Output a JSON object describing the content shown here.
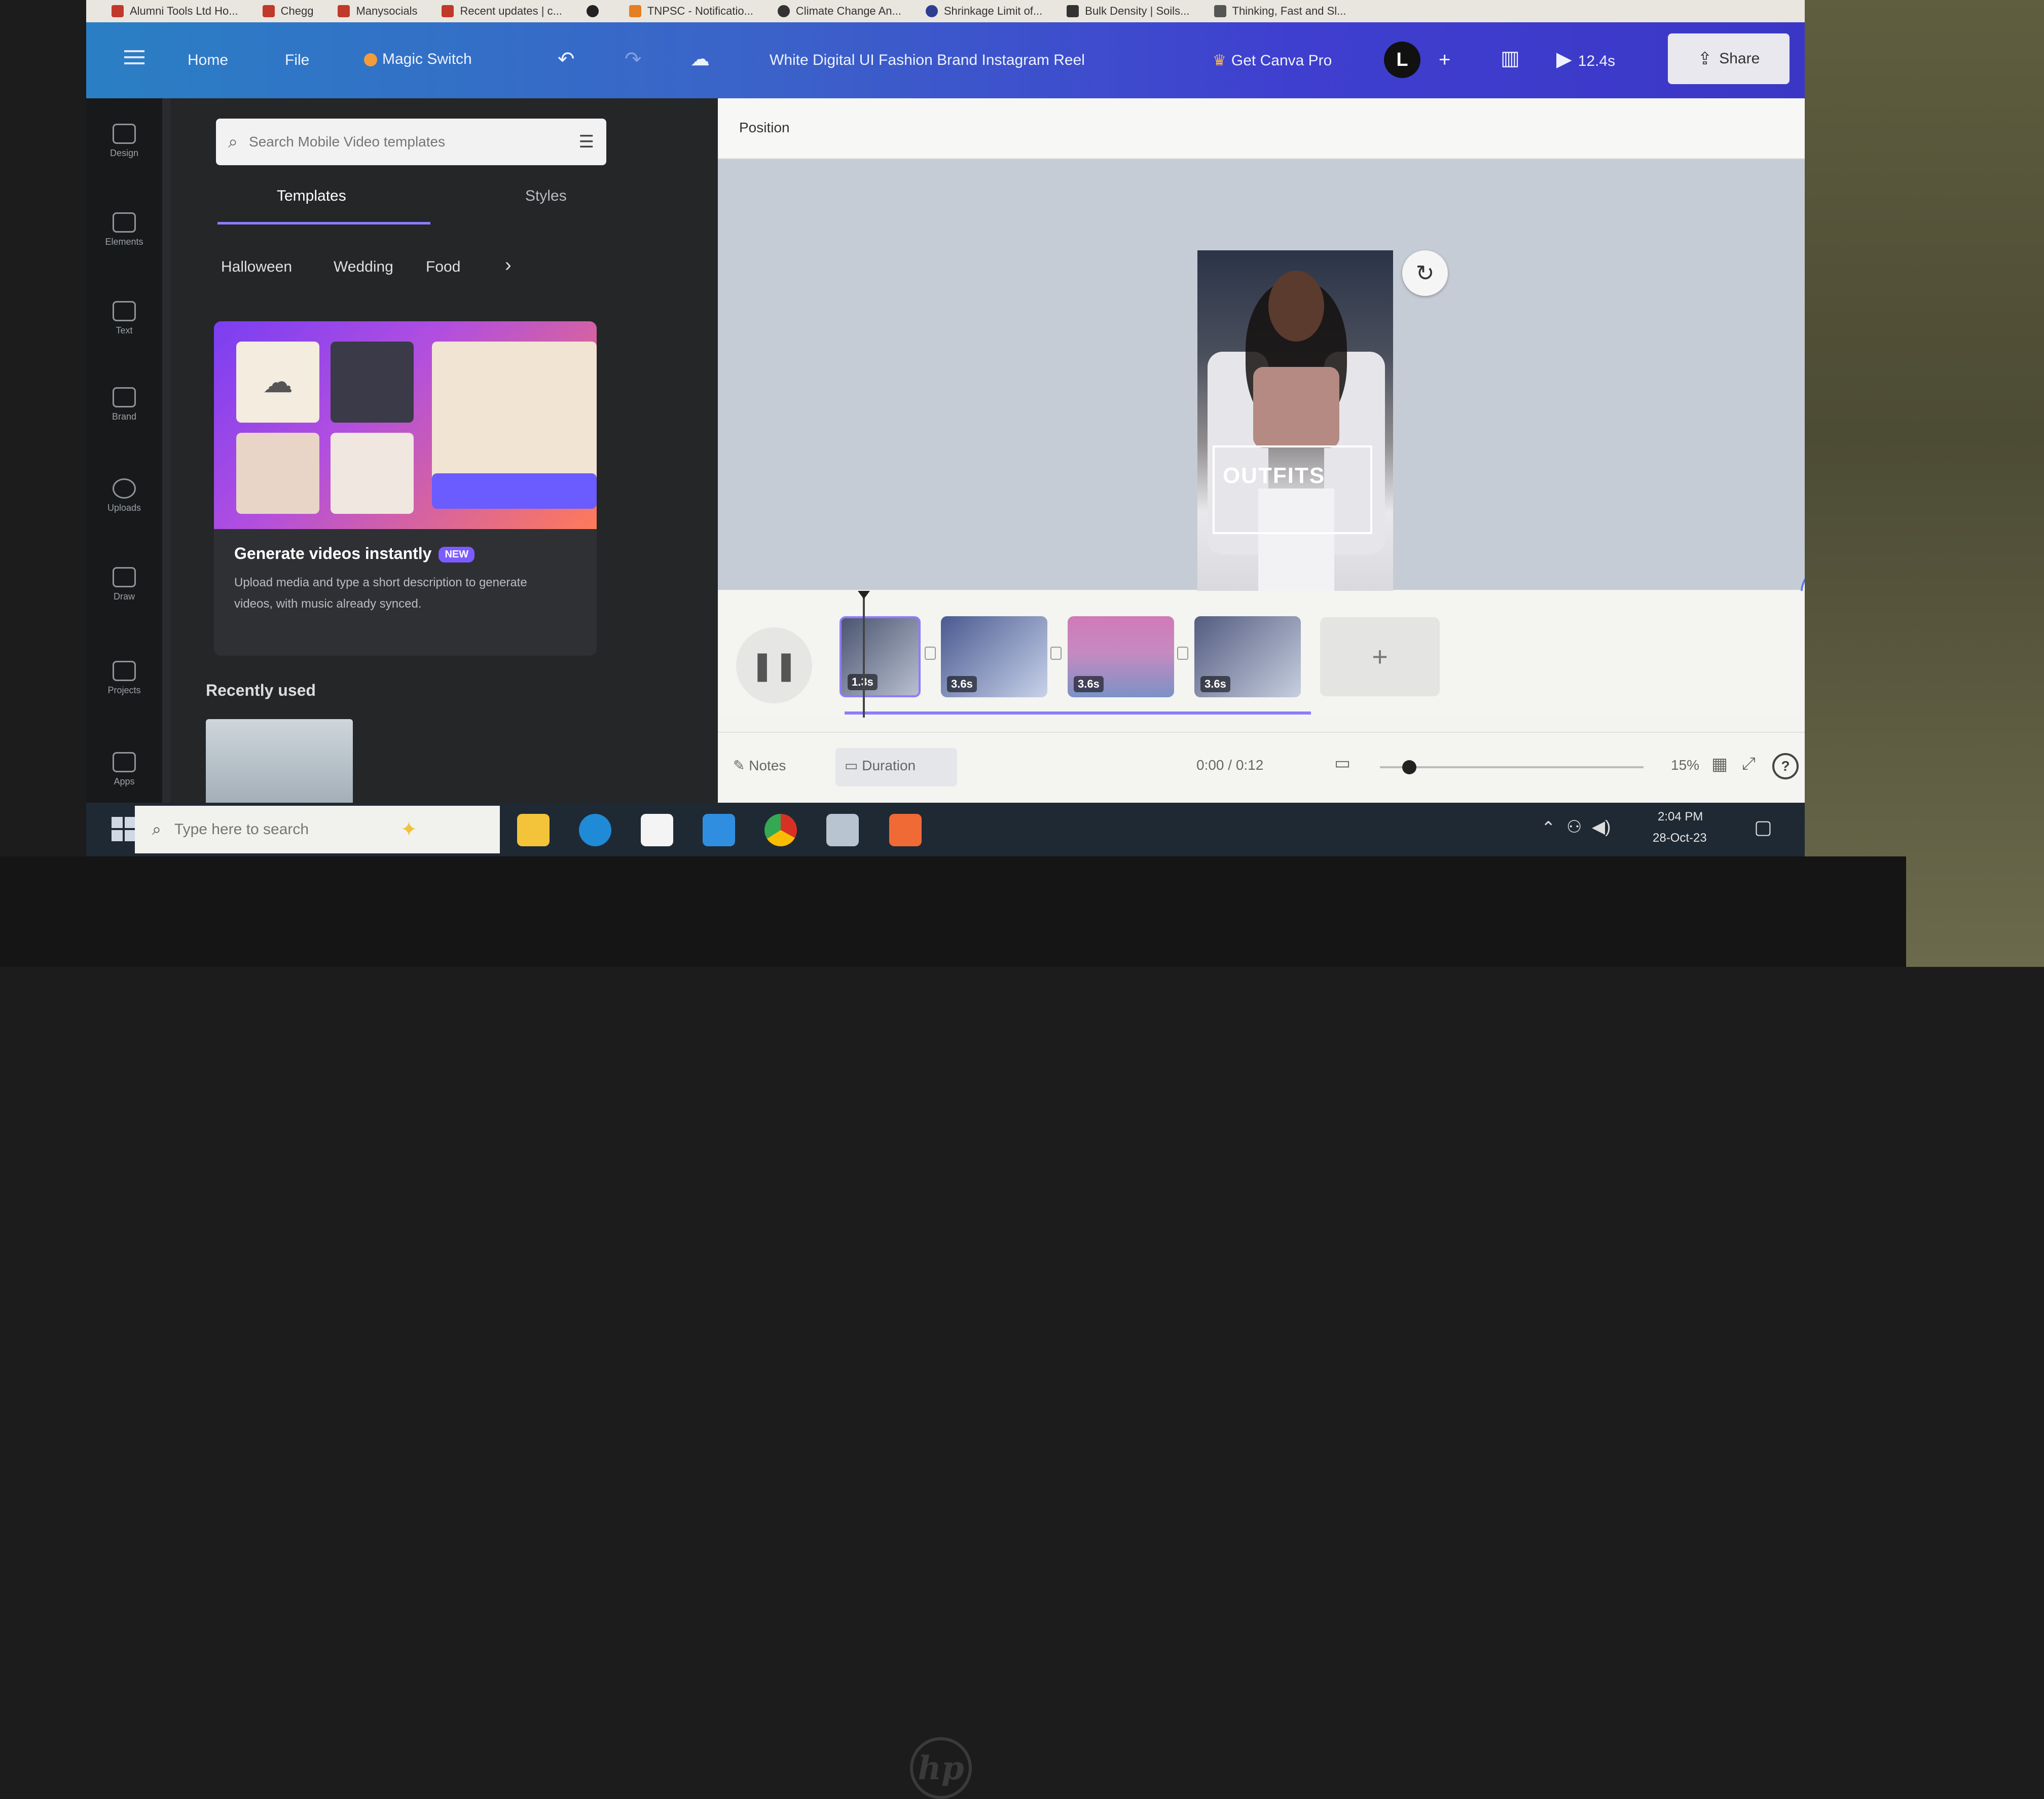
{
  "bookmarks": [
    {
      "label": "Alumni Tools Ltd Ho..."
    },
    {
      "label": "Chegg"
    },
    {
      "label": "Manysocials"
    },
    {
      "label": "Recent updates | c..."
    },
    {
      "label": ""
    },
    {
      "label": "TNPSC - Notificatio..."
    },
    {
      "label": "Climate Change An..."
    },
    {
      "label": "Shrinkage Limit of..."
    },
    {
      "label": "Bulk Density | Soils..."
    },
    {
      "label": "Thinking, Fast and Sl..."
    }
  ],
  "topbar": {
    "home": "Home",
    "file": "File",
    "magic_switch": "Magic Switch",
    "doc_title": "White Digital UI Fashion Brand Instagram Reel",
    "get_pro": "Get Canva Pro",
    "avatar_initial": "L",
    "plus": "+",
    "play_duration": "12.4s",
    "share": "Share"
  },
  "rail": {
    "items": [
      {
        "label": "Design"
      },
      {
        "label": "Elements"
      },
      {
        "label": "Text"
      },
      {
        "label": "Brand"
      },
      {
        "label": "Uploads"
      },
      {
        "label": "Draw"
      },
      {
        "label": "Projects"
      },
      {
        "label": "Apps"
      }
    ]
  },
  "panel": {
    "search_placeholder": "Search Mobile Video templates",
    "tabs": [
      {
        "label": "Templates"
      },
      {
        "label": "Styles"
      }
    ],
    "chips": [
      {
        "label": "Halloween"
      },
      {
        "label": "Wedding"
      },
      {
        "label": "Food"
      }
    ],
    "card": {
      "title": "Generate videos instantly",
      "badge": "NEW",
      "description": "Upload media and type a short description to generate videos, with music already synced."
    },
    "recently_used": "Recently used"
  },
  "editor": {
    "context_label": "Position",
    "design_title": "OUTFITS",
    "design_subtitle": "",
    "clips": [
      {
        "duration": "1.3s"
      },
      {
        "duration": "3.6s"
      },
      {
        "duration": "3.6s"
      },
      {
        "duration": "3.6s"
      }
    ],
    "add_clip": "+"
  },
  "footer": {
    "notes": "Notes",
    "duration": "Duration",
    "time": "0:00 / 0:12",
    "zoom": "15%",
    "help": "?"
  },
  "taskbar": {
    "search_placeholder": "Type here to search",
    "time": "2:04 PM",
    "date": "28-Oct-23"
  },
  "colors": {
    "topbar_start": "#2a7fc4",
    "topbar_end": "#3b37c6",
    "accent_purple": "#8b7dff",
    "panel_bg": "#252627",
    "canvas_bg": "#c6ccd6"
  },
  "progress": {
    "timeline_position_fraction": 0.0
  }
}
